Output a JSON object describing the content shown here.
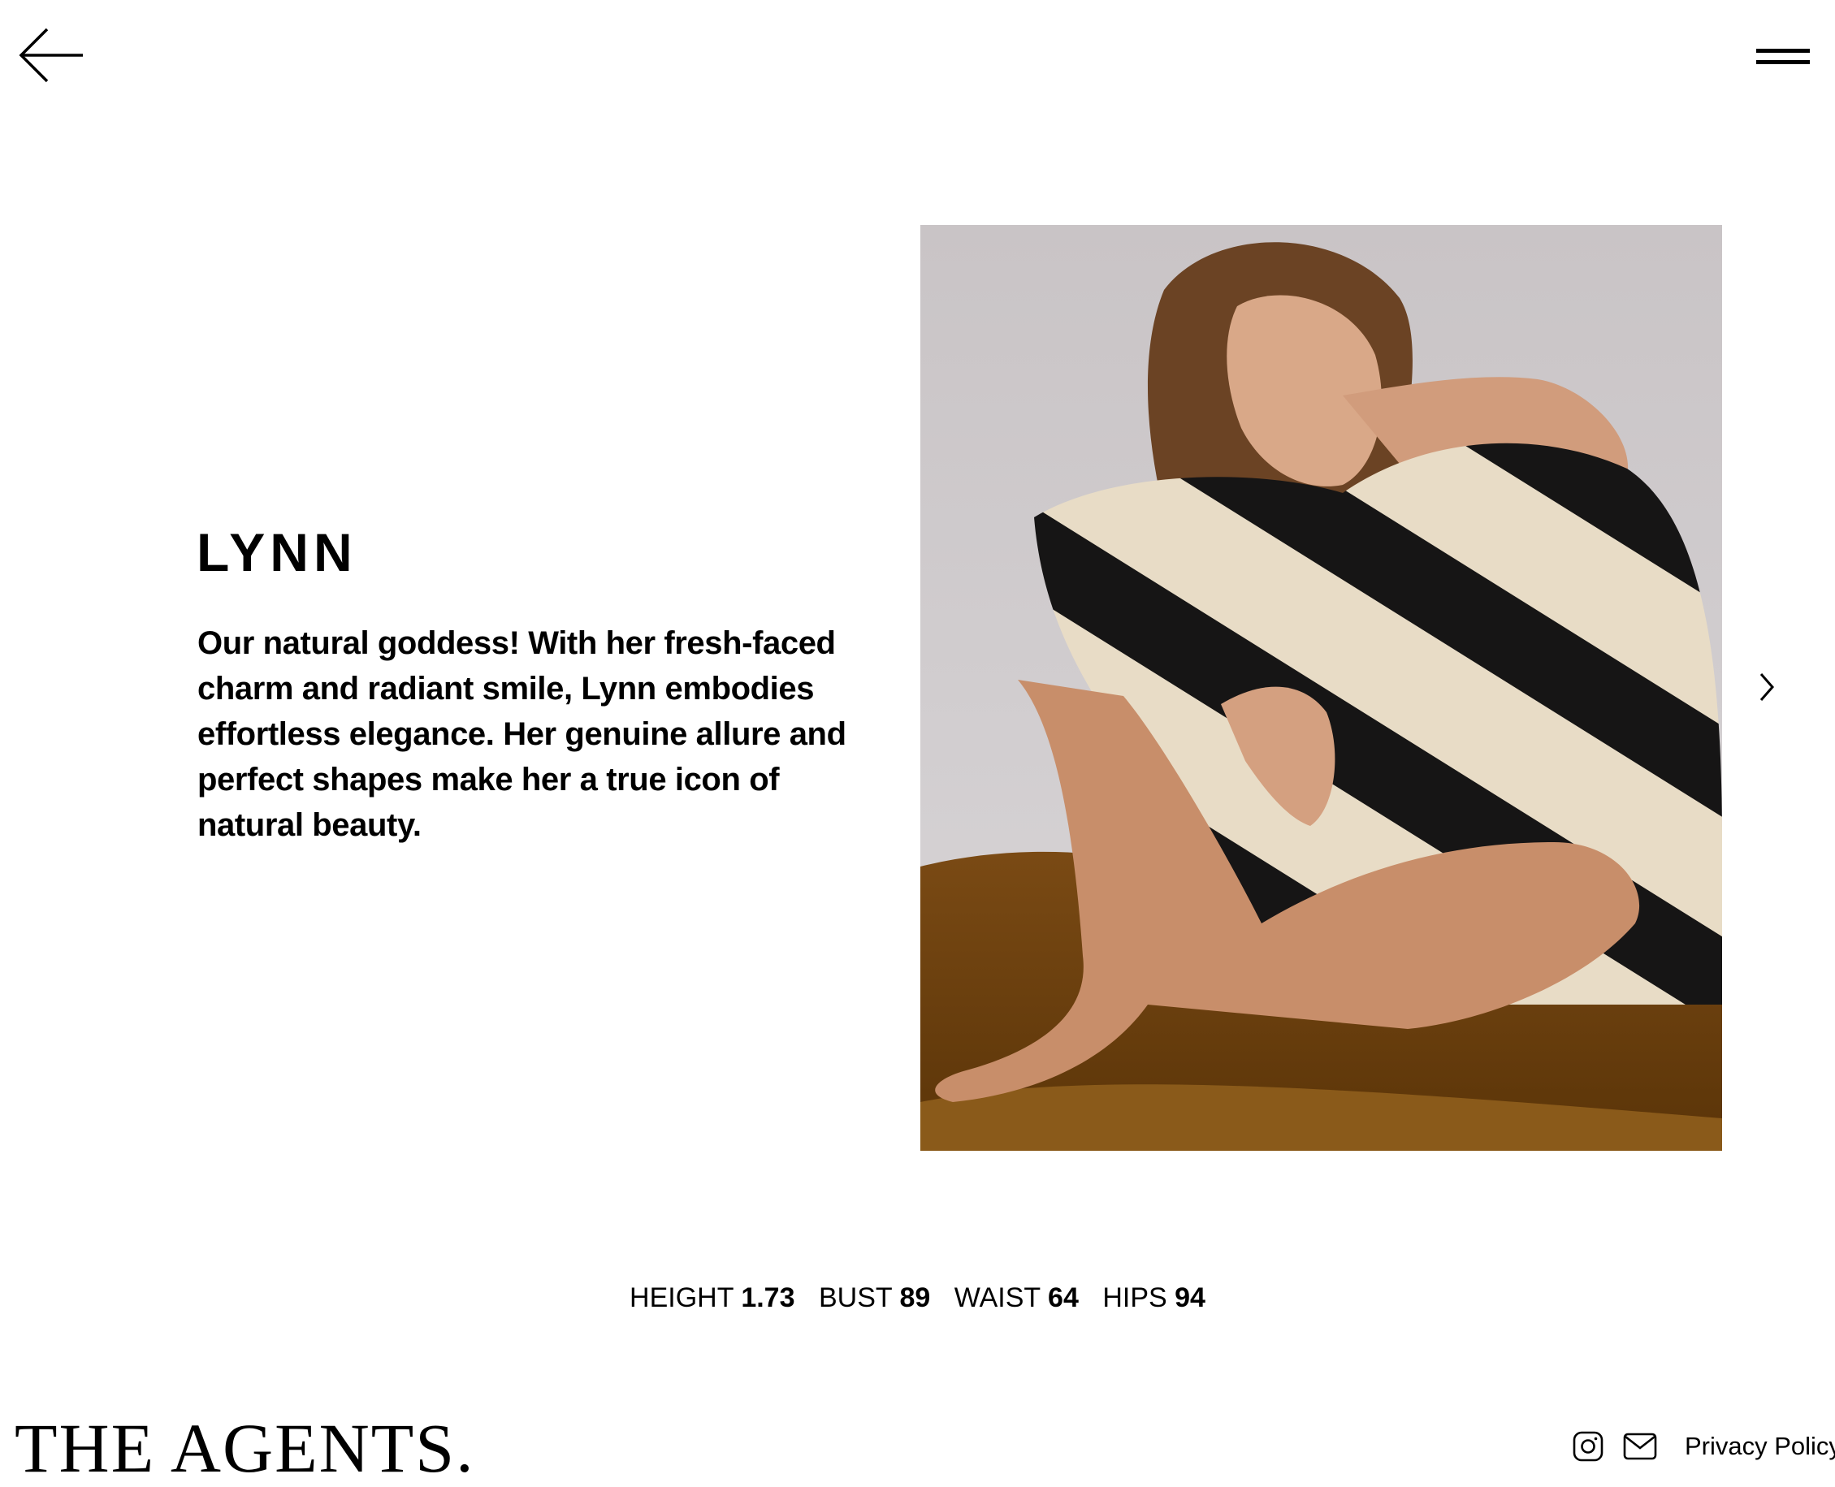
{
  "header": {
    "back_icon": "arrow-left-icon",
    "menu_icon": "hamburger-menu-icon"
  },
  "model": {
    "name": "LYNN",
    "bio": "Our natural goddess! With her fresh-faced charm and radiant smile, Lynn embodies effortless elegance. Her genuine allure and perfect shapes make her a true icon of natural beauty."
  },
  "gallery": {
    "next_icon": "chevron-right-icon"
  },
  "measurements": [
    {
      "label": "HEIGHT",
      "value": "1.73"
    },
    {
      "label": "BUST",
      "value": "89"
    },
    {
      "label": "WAIST",
      "value": "64"
    },
    {
      "label": "HIPS",
      "value": "94"
    }
  ],
  "footer": {
    "logo": "THE AGENTS.",
    "instagram_icon": "instagram-icon",
    "email_icon": "envelope-icon",
    "privacy_label": "Privacy Policy"
  },
  "colors": {
    "background": "#ffffff",
    "text": "#000000"
  }
}
